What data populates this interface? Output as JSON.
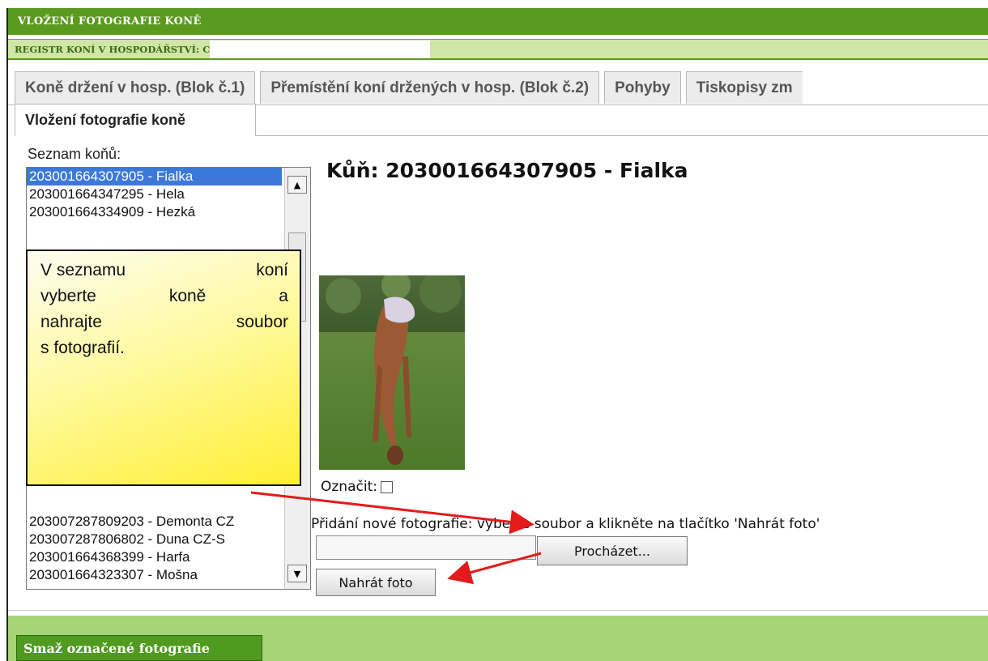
{
  "header": {
    "title": "VLOŽENÍ FOTOGRAFIE KONĚ",
    "subtitle": "REGISTR KONÍ V HOSPODÁŘSTVÍ: C"
  },
  "tabs": [
    {
      "label": "Koně držení v hosp. (Blok č.1)"
    },
    {
      "label": "Přemístění koní držených v hosp. (Blok č.2)"
    },
    {
      "label": "Pohyby"
    },
    {
      "label": "Tiskopisy zm"
    }
  ],
  "subtab": {
    "label": "Vložení fotografie koně"
  },
  "horse_list": {
    "label": "Seznam koňů:",
    "items_top": [
      "203001664307905 - Fialka",
      "203001664347295 - Hela",
      "203001664334909 - Hezká"
    ],
    "items_bottom": [
      "203007287809203 - Demonta CZ",
      "203007287806802 - Duna CZ-S",
      "203001664368399 - Harfa",
      "203001664323307 - Mošna"
    ],
    "selected_index": 0
  },
  "note": {
    "lines": [
      [
        "V seznamu",
        "koní"
      ],
      [
        "vyberte",
        "koně",
        "a"
      ],
      [
        "nahrajte",
        "soubor"
      ],
      [
        "s fotografií."
      ]
    ]
  },
  "main": {
    "horse_title": "Kůň: 203001664307905 - Fialka",
    "mark_label": "Označit:",
    "add_hint": "Přidání nové fotografie: vyberte soubor a klikněte na tlačítko 'Nahrát foto'",
    "file_input_value": "",
    "browse_label": "Procházet...",
    "upload_label": "Nahrát foto"
  },
  "footer": {
    "delete_label": "Smaž označené fotografie"
  },
  "colors": {
    "title_bar": "#5a9a1f",
    "subbar": "#cfe6a7",
    "footer": "#a6d476",
    "selected_row": "#3c78d8",
    "arrow": "#e31b1b",
    "note_yellow": "#ffee33"
  }
}
